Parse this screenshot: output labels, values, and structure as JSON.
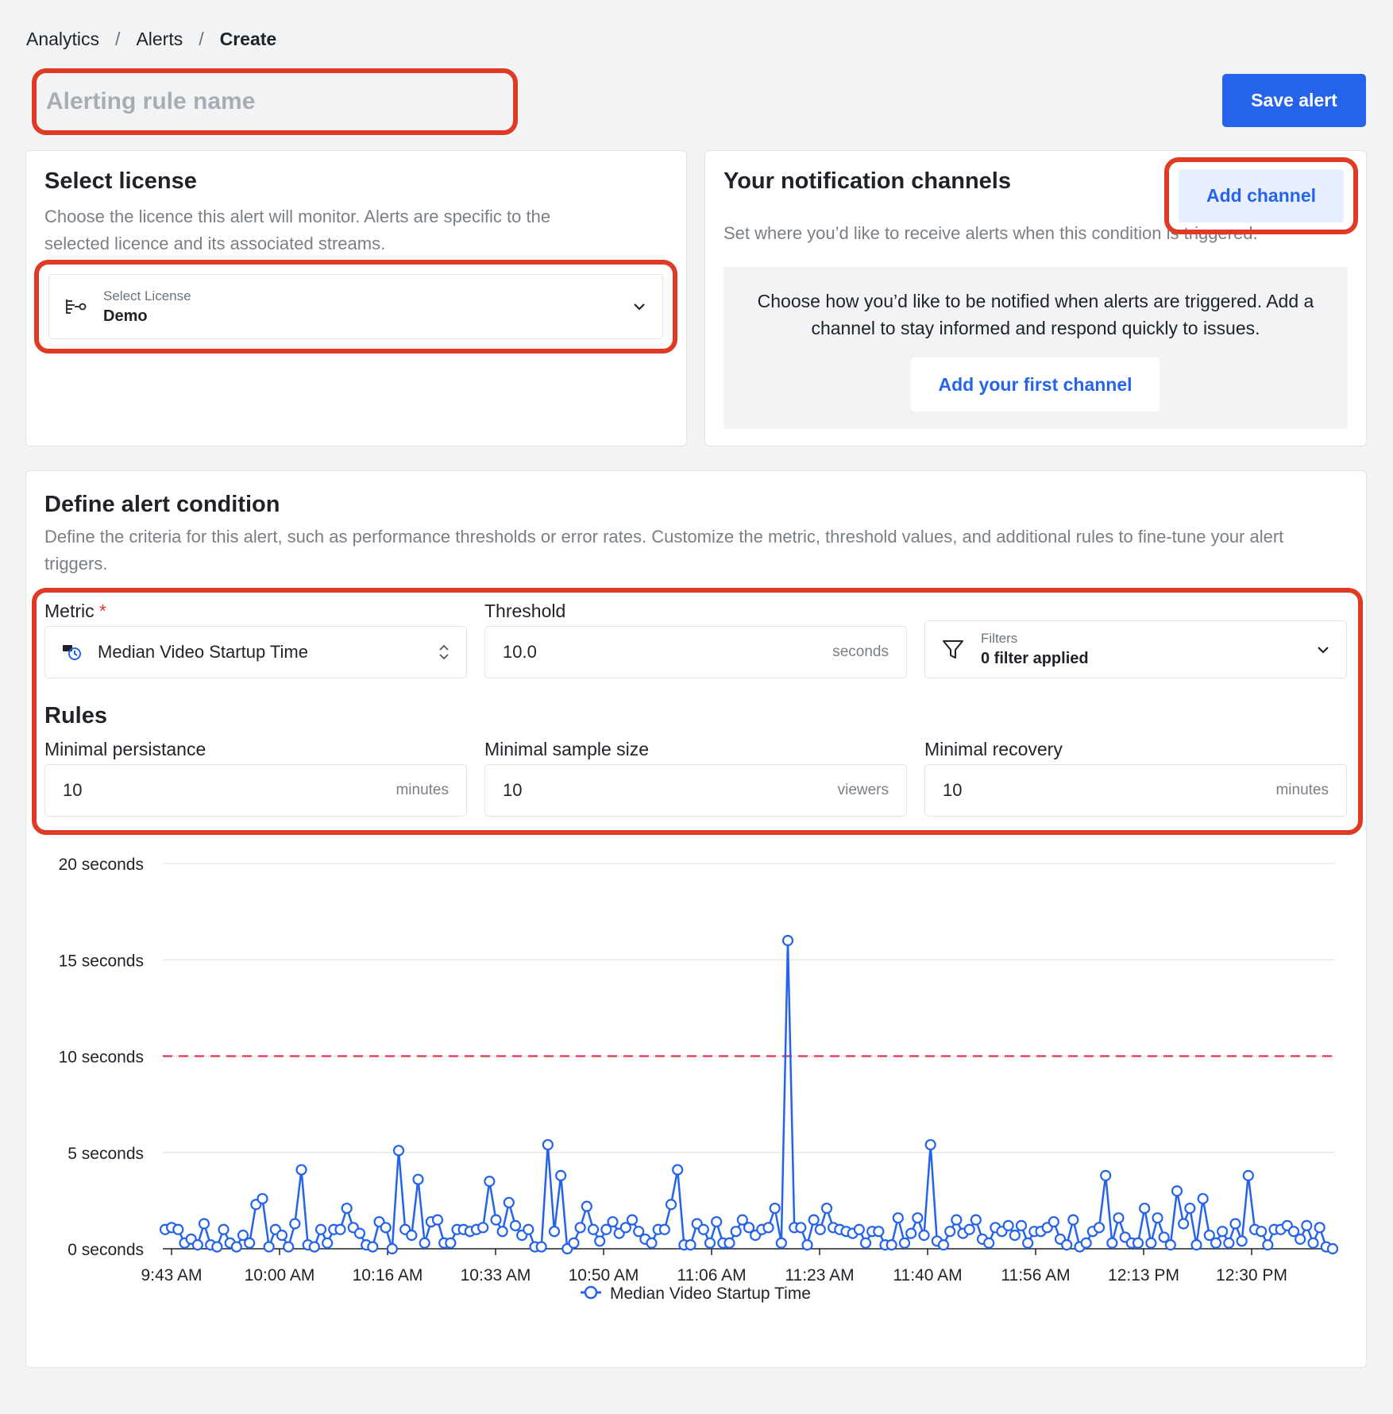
{
  "breadcrumb": [
    "Analytics",
    "Alerts",
    "Create"
  ],
  "rule_name": {
    "placeholder": "Alerting rule name",
    "value": ""
  },
  "save_label": "Save alert",
  "license": {
    "title": "Select license",
    "description": "Choose the licence this alert will monitor. Alerts are specific to the selected licence and its associated streams.",
    "select_label": "Select License",
    "select_value": "Demo"
  },
  "notifications": {
    "title": "Your notification channels",
    "add_label": "Add channel",
    "description": "Set where you’d like to receive alerts when this condition is triggered.",
    "empty_text": "Choose how you’d like to be notified when alerts are triggered. Add a channel to stay informed and respond quickly to issues.",
    "first_channel_label": "Add your first channel"
  },
  "condition": {
    "title": "Define alert condition",
    "description": "Define the criteria for this alert, such as performance thresholds or error rates. Customize the metric, threshold values, and additional rules to fine-tune your alert triggers.",
    "metric_label": "Metric",
    "required_mark": "*",
    "metric_value": "Median Video Startup Time",
    "threshold_label": "Threshold",
    "threshold_value": "10.0",
    "threshold_unit": "seconds",
    "filters_label": "Filters",
    "filters_value": "0 filter applied",
    "rules_title": "Rules",
    "persistence_label": "Minimal persistance",
    "persistence_value": "10",
    "persistence_unit": "minutes",
    "sample_label": "Minimal sample size",
    "sample_value": "10",
    "sample_unit": "viewers",
    "recovery_label": "Minimal recovery",
    "recovery_value": "10",
    "recovery_unit": "minutes"
  },
  "colors": {
    "accent": "#2563eb",
    "highlight": "#e03a24",
    "threshold_line": "#e8435a"
  },
  "chart_data": {
    "type": "line",
    "y_tick_labels": [
      "0 seconds",
      "5 seconds",
      "10 seconds",
      "15 seconds",
      "20 seconds"
    ],
    "ylim": [
      0,
      20
    ],
    "x_tick_labels": [
      "9:43 AM",
      "10:00 AM",
      "10:16 AM",
      "10:33 AM",
      "10:50 AM",
      "11:06 AM",
      "11:23 AM",
      "11:40 AM",
      "11:56 AM",
      "12:13 PM",
      "12:30 PM"
    ],
    "threshold": 10,
    "series": [
      {
        "name": "Median Video Startup Time",
        "values": [
          1.0,
          1.1,
          1.0,
          0.3,
          0.5,
          0.2,
          1.3,
          0.2,
          0.1,
          1.0,
          0.3,
          0.1,
          0.7,
          0.3,
          2.3,
          2.6,
          0.1,
          1.0,
          0.7,
          0.1,
          1.3,
          4.1,
          0.2,
          0.1,
          1.0,
          0.3,
          1.0,
          1.0,
          2.1,
          1.1,
          0.8,
          0.2,
          0.1,
          1.4,
          1.1,
          0.0,
          5.1,
          1.0,
          0.7,
          3.6,
          0.3,
          1.4,
          1.5,
          0.3,
          0.3,
          1.0,
          1.0,
          0.9,
          1.0,
          1.1,
          3.5,
          1.5,
          0.9,
          2.4,
          1.2,
          0.7,
          1.0,
          0.1,
          0.1,
          5.4,
          0.9,
          3.8,
          0.0,
          0.3,
          1.1,
          2.2,
          1.0,
          0.4,
          1.0,
          1.4,
          0.8,
          1.1,
          1.5,
          0.9,
          0.5,
          0.3,
          1.0,
          1.0,
          2.3,
          4.1,
          0.2,
          0.2,
          1.3,
          1.0,
          0.3,
          1.4,
          0.3,
          0.3,
          0.9,
          1.5,
          1.1,
          0.7,
          1.0,
          1.1,
          2.1,
          0.3,
          16.0,
          1.1,
          1.1,
          0.2,
          1.5,
          1.0,
          2.1,
          1.1,
          1.0,
          0.9,
          0.8,
          1.0,
          0.3,
          0.9,
          0.9,
          0.2,
          0.2,
          1.6,
          0.3,
          0.8,
          1.6,
          0.7,
          5.4,
          0.4,
          0.2,
          0.9,
          1.5,
          0.8,
          1.0,
          1.5,
          0.5,
          0.3,
          1.1,
          0.9,
          1.2,
          0.7,
          1.2,
          0.3,
          0.9,
          0.9,
          1.1,
          1.4,
          0.5,
          0.2,
          1.5,
          0.1,
          0.3,
          0.9,
          1.1,
          3.8,
          0.3,
          1.6,
          0.6,
          0.3,
          0.3,
          2.1,
          0.3,
          1.6,
          0.6,
          0.2,
          3.0,
          1.3,
          2.1,
          0.2,
          2.6,
          0.7,
          0.3,
          0.9,
          0.3,
          1.3,
          0.4,
          3.8,
          1.0,
          0.9,
          0.2,
          1.0,
          1.0,
          1.2,
          0.9,
          0.5,
          1.2,
          0.3,
          1.1,
          0.1,
          0.0
        ]
      }
    ]
  }
}
